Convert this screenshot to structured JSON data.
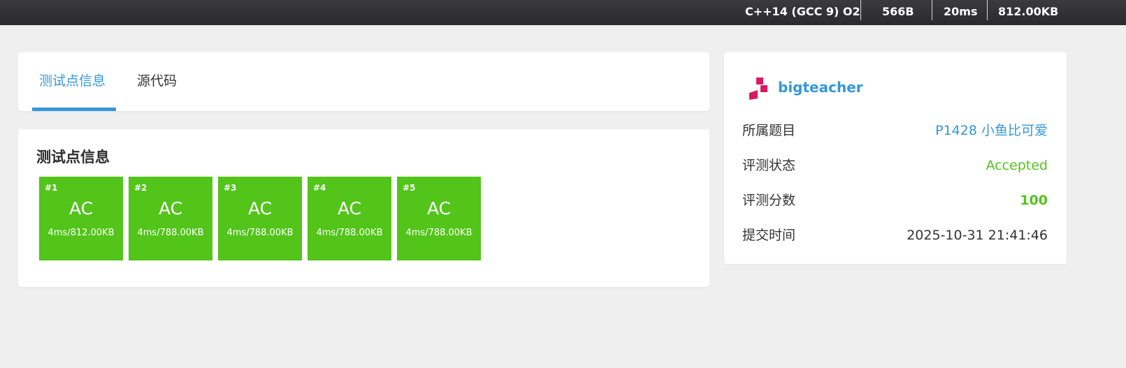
{
  "topbar": {
    "language": "C++14 (GCC 9) O2",
    "code_size": "566B",
    "time": "20ms",
    "memory": "812.00KB"
  },
  "tabs": [
    {
      "label": "测试点信息",
      "active": true
    },
    {
      "label": "源代码",
      "active": false
    }
  ],
  "testcases": {
    "title": "测试点信息",
    "items": [
      {
        "num": "#1",
        "verdict": "AC",
        "detail": "4ms/812.00KB"
      },
      {
        "num": "#2",
        "verdict": "AC",
        "detail": "4ms/788.00KB"
      },
      {
        "num": "#3",
        "verdict": "AC",
        "detail": "4ms/788.00KB"
      },
      {
        "num": "#4",
        "verdict": "AC",
        "detail": "4ms/788.00KB"
      },
      {
        "num": "#5",
        "verdict": "AC",
        "detail": "4ms/788.00KB"
      }
    ],
    "color": "#52c41a"
  },
  "sidebar": {
    "user": {
      "name": "bigteacher",
      "avatar_icon": "user-logo-icon",
      "logo_color": "#d81b60"
    },
    "info": [
      {
        "label": "所属题目",
        "value": "P1428 小鱼比可爱",
        "color": "#3498db"
      },
      {
        "label": "评测状态",
        "value": "Accepted",
        "color": "#52c41a"
      },
      {
        "label": "评测分数",
        "value": "100",
        "color": "#52c41a"
      },
      {
        "label": "提交时间",
        "value": "2025-10-31 21:41:46",
        "color": "#333333"
      }
    ]
  },
  "colors": {
    "accent": "#3498db",
    "success": "#52c41a",
    "background": "#efefef"
  }
}
